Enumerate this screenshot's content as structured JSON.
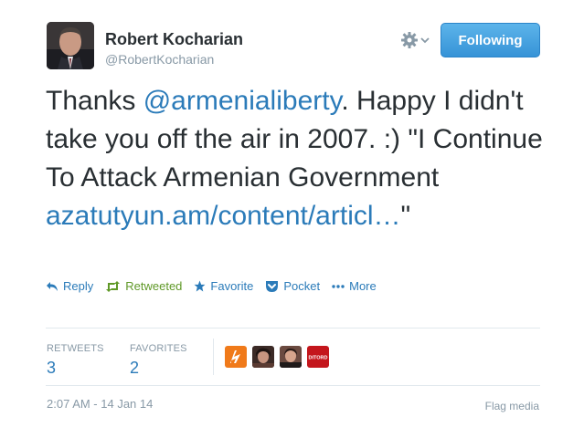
{
  "author": {
    "display_name": "Robert Kocharian",
    "screen_name": "@RobertKocharian",
    "avatar_icon": "portrait-avatar"
  },
  "follow_button": {
    "label": "Following",
    "color": "#3b94d9"
  },
  "tweet": {
    "text_before_mention": "Thanks ",
    "mention": "@armenialiberty",
    "text_after_mention": ". Happy I didn't take you off the air in 2007. :) \"I Continue To Attack Armenian Government ",
    "link": "azatutyun.am/content/articl…",
    "text_end": "\""
  },
  "actions": {
    "reply": "Reply",
    "retweeted": "Retweeted",
    "favorite": "Favorite",
    "pocket": "Pocket",
    "more": "More"
  },
  "stats": {
    "retweets_label": "RETWEETS",
    "retweets_count": "3",
    "favorites_label": "FAVORITES",
    "favorites_count": "2"
  },
  "faces": [
    {
      "icon": "rferl-logo-avatar"
    },
    {
      "icon": "person-avatar"
    },
    {
      "icon": "person-avatar"
    },
    {
      "icon": "ditord-logo-avatar",
      "text": "DITORD"
    }
  ],
  "timestamp": "2:07 AM - 14 Jan 14",
  "flag_media": "Flag media",
  "colors": {
    "link": "#2b7bb9",
    "retweeted": "#609928",
    "muted": "#8899a6"
  }
}
